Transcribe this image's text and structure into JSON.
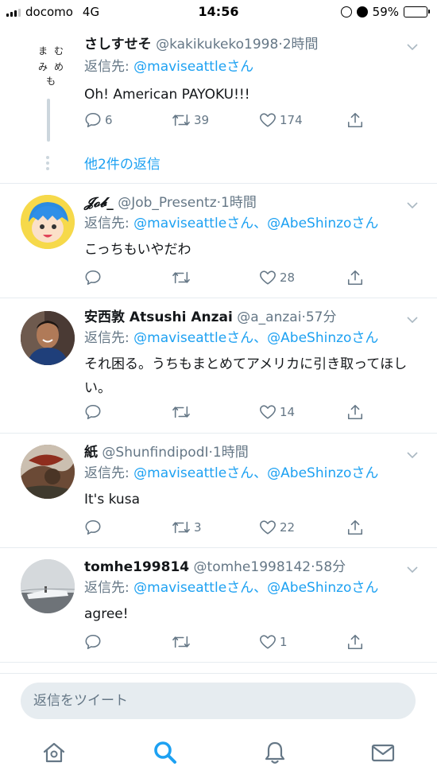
{
  "status_bar": {
    "carrier": "docomo",
    "network": "4G",
    "time": "14:56",
    "battery": "59%",
    "battery_level": 0.59
  },
  "thread_top": {
    "avatar_text": [
      "む",
      "ま",
      "め",
      "み",
      "も"
    ],
    "name": "さしすせそ",
    "handle": "@kakikukeko1998",
    "time": "2時間",
    "reply_prefix": "返信先:",
    "reply_to": "@maviseattleさん",
    "text": "Oh! American PAYOKU!!!",
    "replies": "6",
    "retweets": "39",
    "likes": "174",
    "more_replies": "他2件の返信"
  },
  "tweets": [
    {
      "name": "𝓙𝓸𝓫_",
      "handle": "@Job_Presentz",
      "time": "1時間",
      "reply_prefix": "返信先:",
      "reply_to": "@maviseattleさん、@AbeShinzoさん",
      "text": "こっちもいやだわ",
      "replies": "",
      "retweets": "",
      "likes": "28"
    },
    {
      "name": "安西敦 Atsushi Anzai",
      "handle": "@a_anzai",
      "time": "57分",
      "reply_prefix": "返信先:",
      "reply_to": "@maviseattleさん、@AbeShinzoさん",
      "text": "それ困る。うちもまとめてアメリカに引き取ってほしい。",
      "replies": "",
      "retweets": "",
      "likes": "14"
    },
    {
      "name": "紙",
      "handle": "@ShunfindipodI",
      "time": "1時間",
      "reply_prefix": "返信先:",
      "reply_to": "@maviseattleさん、@AbeShinzoさん",
      "text": "It's kusa",
      "replies": "",
      "retweets": "3",
      "likes": "22"
    },
    {
      "name": "tomhe199814",
      "handle": "@tomhe1998142",
      "time": "58分",
      "reply_prefix": "返信先:",
      "reply_to": "@maviseattleさん、@AbeShinzoさん",
      "text": "agree!",
      "replies": "",
      "retweets": "",
      "likes": "1"
    }
  ],
  "compose": {
    "placeholder": "返信をツイート"
  },
  "tabbar": {
    "items": [
      "home-icon",
      "search-icon",
      "bell-icon",
      "mail-icon"
    ],
    "active": "search-icon"
  },
  "colors": {
    "accent": "#1da1f2",
    "muted": "#657786",
    "divider": "#e6ecf0"
  }
}
